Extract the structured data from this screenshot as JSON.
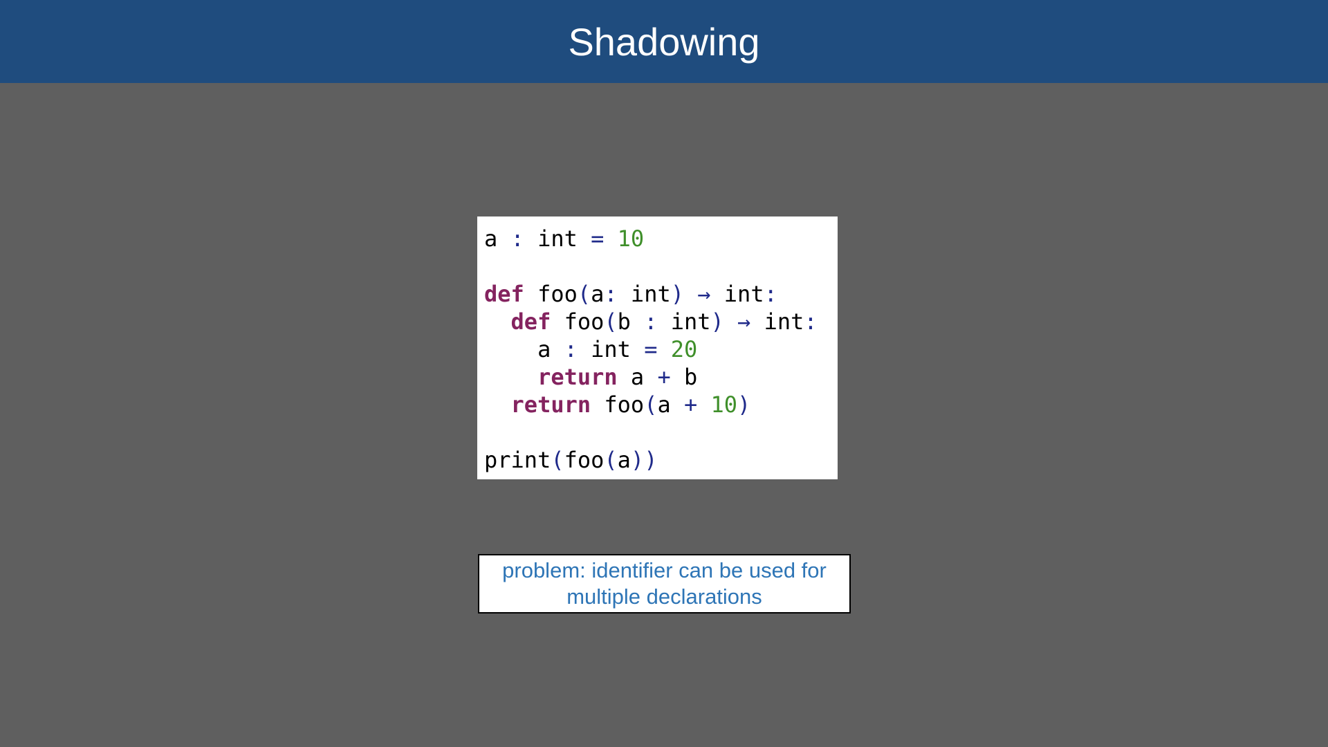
{
  "slide": {
    "title": "Shadowing"
  },
  "colors": {
    "header_bg": "#1f4c7e",
    "page_bg": "#5f5f5f",
    "keyword": "#84235f",
    "operator": "#1f2a8a",
    "number": "#3f8f2a",
    "note_text": "#2e75b6"
  },
  "code": {
    "lines": [
      [
        {
          "t": "a",
          "k": "id"
        },
        {
          "t": " ",
          "k": "id"
        },
        {
          "t": ":",
          "k": "op"
        },
        {
          "t": " int ",
          "k": "id"
        },
        {
          "t": "=",
          "k": "op"
        },
        {
          "t": " ",
          "k": "id"
        },
        {
          "t": "10",
          "k": "num"
        }
      ],
      [],
      [
        {
          "t": "def",
          "k": "kw"
        },
        {
          "t": " foo",
          "k": "id"
        },
        {
          "t": "(",
          "k": "op"
        },
        {
          "t": "a",
          "k": "id"
        },
        {
          "t": ":",
          "k": "op"
        },
        {
          "t": " int",
          "k": "id"
        },
        {
          "t": ")",
          "k": "op"
        },
        {
          "t": " ",
          "k": "id"
        },
        {
          "t": "→",
          "k": "op"
        },
        {
          "t": " int",
          "k": "id"
        },
        {
          "t": ":",
          "k": "op"
        }
      ],
      [
        {
          "t": "  ",
          "k": "id"
        },
        {
          "t": "def",
          "k": "kw"
        },
        {
          "t": " foo",
          "k": "id"
        },
        {
          "t": "(",
          "k": "op"
        },
        {
          "t": "b ",
          "k": "id"
        },
        {
          "t": ":",
          "k": "op"
        },
        {
          "t": " int",
          "k": "id"
        },
        {
          "t": ")",
          "k": "op"
        },
        {
          "t": " ",
          "k": "id"
        },
        {
          "t": "→",
          "k": "op"
        },
        {
          "t": " int",
          "k": "id"
        },
        {
          "t": ":",
          "k": "op"
        }
      ],
      [
        {
          "t": "    a ",
          "k": "id"
        },
        {
          "t": ":",
          "k": "op"
        },
        {
          "t": " int ",
          "k": "id"
        },
        {
          "t": "=",
          "k": "op"
        },
        {
          "t": " ",
          "k": "id"
        },
        {
          "t": "20",
          "k": "num"
        }
      ],
      [
        {
          "t": "    ",
          "k": "id"
        },
        {
          "t": "return",
          "k": "kw"
        },
        {
          "t": " a ",
          "k": "id"
        },
        {
          "t": "+",
          "k": "op"
        },
        {
          "t": " b",
          "k": "id"
        }
      ],
      [
        {
          "t": "  ",
          "k": "id"
        },
        {
          "t": "return",
          "k": "kw"
        },
        {
          "t": " foo",
          "k": "id"
        },
        {
          "t": "(",
          "k": "op"
        },
        {
          "t": "a ",
          "k": "id"
        },
        {
          "t": "+",
          "k": "op"
        },
        {
          "t": " ",
          "k": "id"
        },
        {
          "t": "10",
          "k": "num"
        },
        {
          "t": ")",
          "k": "op"
        }
      ],
      [],
      [
        {
          "t": "print",
          "k": "id"
        },
        {
          "t": "(",
          "k": "op"
        },
        {
          "t": "foo",
          "k": "id"
        },
        {
          "t": "(",
          "k": "op"
        },
        {
          "t": "a",
          "k": "id"
        },
        {
          "t": "))",
          "k": "op"
        }
      ]
    ]
  },
  "note": {
    "text": "problem: identifier can be used for multiple declarations"
  }
}
